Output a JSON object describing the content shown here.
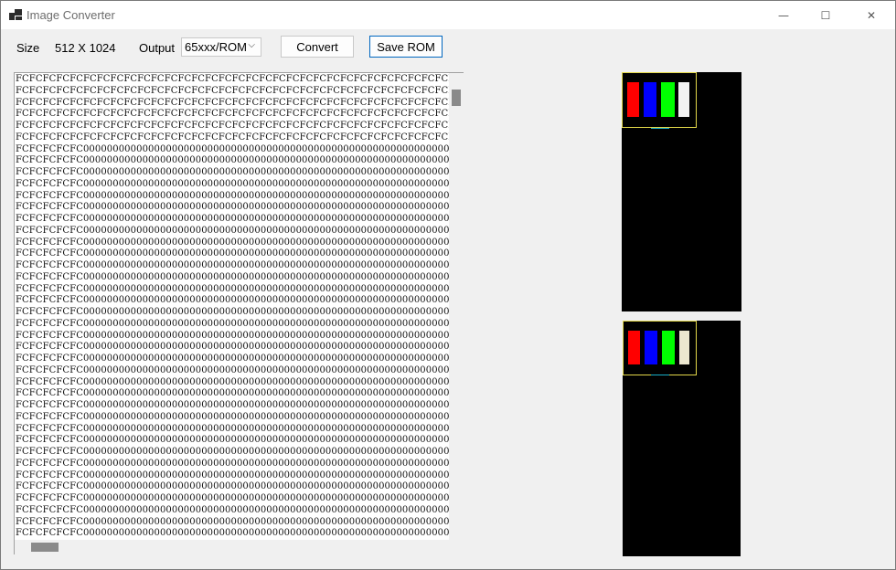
{
  "window": {
    "title": "Image Converter",
    "controls": {
      "minimize": "—",
      "maximize": "☐",
      "close": "✕"
    }
  },
  "toolbar": {
    "size_label": "Size",
    "size_value": "512 X 1024",
    "output_label": "Output",
    "output_value": "65xxx/ROM",
    "convert_label": "Convert",
    "save_label": "Save ROM"
  },
  "hex_dump": {
    "lines": [
      "FCFCFCFCFCFCFCFCFCFCFCFCFCFCFCFCFCFCFCFCFCFCFCFCFCFCFCFCFCFCFCFCFCFCFCFCFC",
      "FCFCFCFCFCFCFCFCFCFCFCFCFCFCFCFCFCFCFCFCFCFCFCFCFCFCFCFCFCFCFCFCFCFCFCFCFC",
      "FCFCFCFCFCFCFCFCFCFCFCFCFCFCFCFCFCFCFCFCFCFCFCFCFCFCFCFCFCFCFCFCFCFCFCFCFC",
      "FCFCFCFCFCFCFCFCFCFCFCFCFCFCFCFCFCFCFCFCFCFCFCFCFCFCFCFCFCFCFCFCFCFCFCFCFC",
      "FCFCFCFCFCFCFCFCFCFCFCFCFCFCFCFCFCFCFCFCFCFCFCFCFCFCFCFCFCFCFCFCFCFCFCFCFC",
      "FCFCFCFCFCFCFCFCFCFCFCFCFCFCFCFCFCFCFCFCFCFCFCFCFCFCFCFCFCFCFCFCFCFCFCFCFC",
      "FCFCFCFCFC000000000000000000000000000000000000000000000000000000000000000000",
      "FCFCFCFCFC000000000000000000000000000000000000000000000000000000000000000000",
      "FCFCFCFCFC000000000000000000000000000000000000000000000000000000000000000000",
      "FCFCFCFCFC000000000000000000000000000000000000000000000000000000000000000000",
      "FCFCFCFCFC000000000000000000000000000000000000000000000000000000000000000000",
      "FCFCFCFCFC000000000000000000000000000000000000000000000000000000000000000000",
      "FCFCFCFCFC000000000000000000000000000000000000000000000000000000000000000000",
      "FCFCFCFCFC000000000000000000000000000000000000000000000000000000000000000000",
      "FCFCFCFCFC000000000000000000000000000000000000000000000000000000000000000000",
      "FCFCFCFCFC000000000000000000000000000000000000000000000000000000000000000000",
      "FCFCFCFCFC000000000000000000000000000000000000000000000000000000000000000000",
      "FCFCFCFCFC000000000000000000000000000000000000000000000000000000000000000000",
      "FCFCFCFCFC000000000000000000000000000000000000000000000000000000000000000000",
      "FCFCFCFCFC000000000000000000000000000000000000000000000000000000000000000000",
      "FCFCFCFCFC000000000000000000000000000000000000000000000000000000000000000000",
      "FCFCFCFCFC000000000000000000000000000000000000000000000000000000000000000000",
      "FCFCFCFCFC000000000000000000000000000000000000000000000000000000000000000000",
      "FCFCFCFCFC000000000000000000000000000000000000000000000000000000000000000000",
      "FCFCFCFCFC000000000000000000000000000000000000000000000000000000000000000000",
      "FCFCFCFCFC000000000000000000000000000000000000000000000000000000000000000000",
      "FCFCFCFCFC000000000000000000000000000000000000000000000000000000000000000000",
      "FCFCFCFCFC000000000000000000000000000000000000000000000000000000000000000000",
      "FCFCFCFCFC000000000000000000000000000000000000000000000000000000000000000000",
      "FCFCFCFCFC000000000000000000000000000000000000000000000000000000000000000000",
      "FCFCFCFCFC000000000000000000000000000000000000000000000000000000000000000000",
      "FCFCFCFCFC000000000000000000000000000000000000000000000000000000000000000000",
      "FCFCFCFCFC000000000000000000000000000000000000000000000000000000000000000000",
      "FCFCFCFCFC000000000000000000000000000000000000000000000000000000000000000000",
      "FCFCFCFCFC000000000000000000000000000000000000000000000000000000000000000000",
      "FCFCFCFCFC000000000000000000000000000000000000000000000000000000000000000000",
      "FCFCFCFCFC000000000000000000000000000000000000000000000000000000000000000000",
      "FCFCFCFCFC000000000000000000000000000000000000000000000000000000000000000000",
      "FCFCFCFCFC000000000000000000000000000000000000000000000000000000000000000000",
      "FCFCFCFCFC000000000000000000000000000000000000000000000000000000000000000000"
    ]
  },
  "previews": {
    "bar_colors": {
      "red": "#ff0000",
      "blue": "#0000ff",
      "green": "#00ff00",
      "white": "#f2f2f2",
      "cream": "#ece7cf",
      "selection": "#e3d84a",
      "cyan_mark": "#1ab0c8"
    }
  }
}
